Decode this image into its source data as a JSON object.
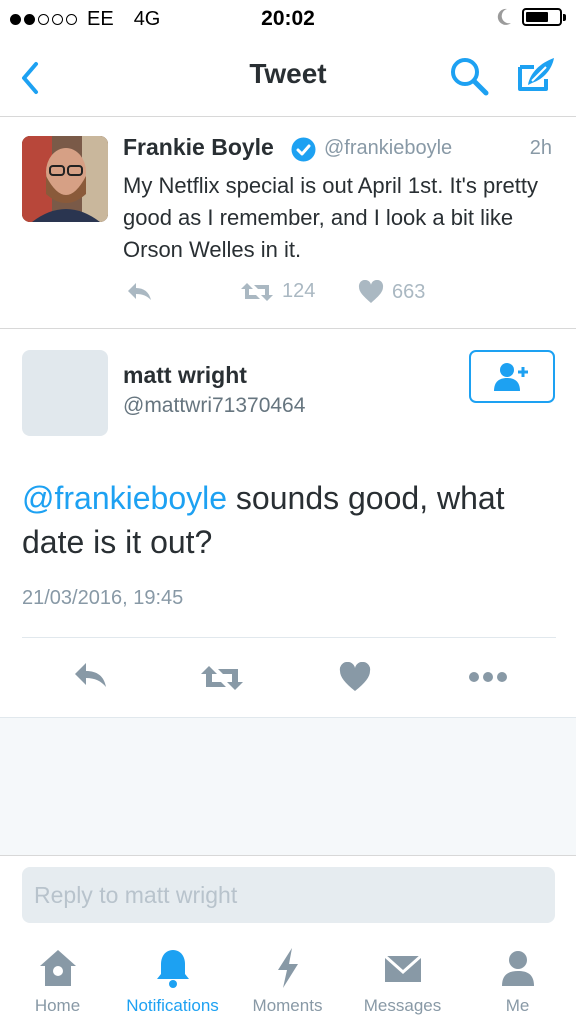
{
  "status_bar": {
    "carrier": "EE",
    "network": "4G",
    "time": "20:02",
    "signal_bars": 2,
    "battery_level": 0.7
  },
  "nav": {
    "title": "Tweet"
  },
  "original_tweet": {
    "author_name": "Frankie Boyle",
    "author_handle": "@frankieboyle",
    "time_ago": "2h",
    "text": "My Netflix special is out April 1st. It's pretty good as I remember, and I look a bit like Orson Welles in it.",
    "retweets": "124",
    "likes": "663"
  },
  "reply_tweet": {
    "author_name": "matt wright",
    "author_handle": "@mattwri71370464",
    "mention": "@frankieboyle",
    "text": " sounds good, what date is it out?",
    "date": "21/03/2016, 19:45"
  },
  "reply_box": {
    "placeholder": "Reply to matt wright"
  },
  "tab_bar": {
    "tabs": [
      {
        "label": "Home",
        "icon": "home-icon"
      },
      {
        "label": "Notifications",
        "icon": "bell-icon"
      },
      {
        "label": "Moments",
        "icon": "lightning-icon"
      },
      {
        "label": "Messages",
        "icon": "envelope-icon"
      },
      {
        "label": "Me",
        "icon": "person-icon"
      }
    ],
    "active": "Notifications"
  },
  "colors": {
    "accent": "#1da1f2",
    "muted": "#8899a6",
    "text": "#292f33"
  }
}
